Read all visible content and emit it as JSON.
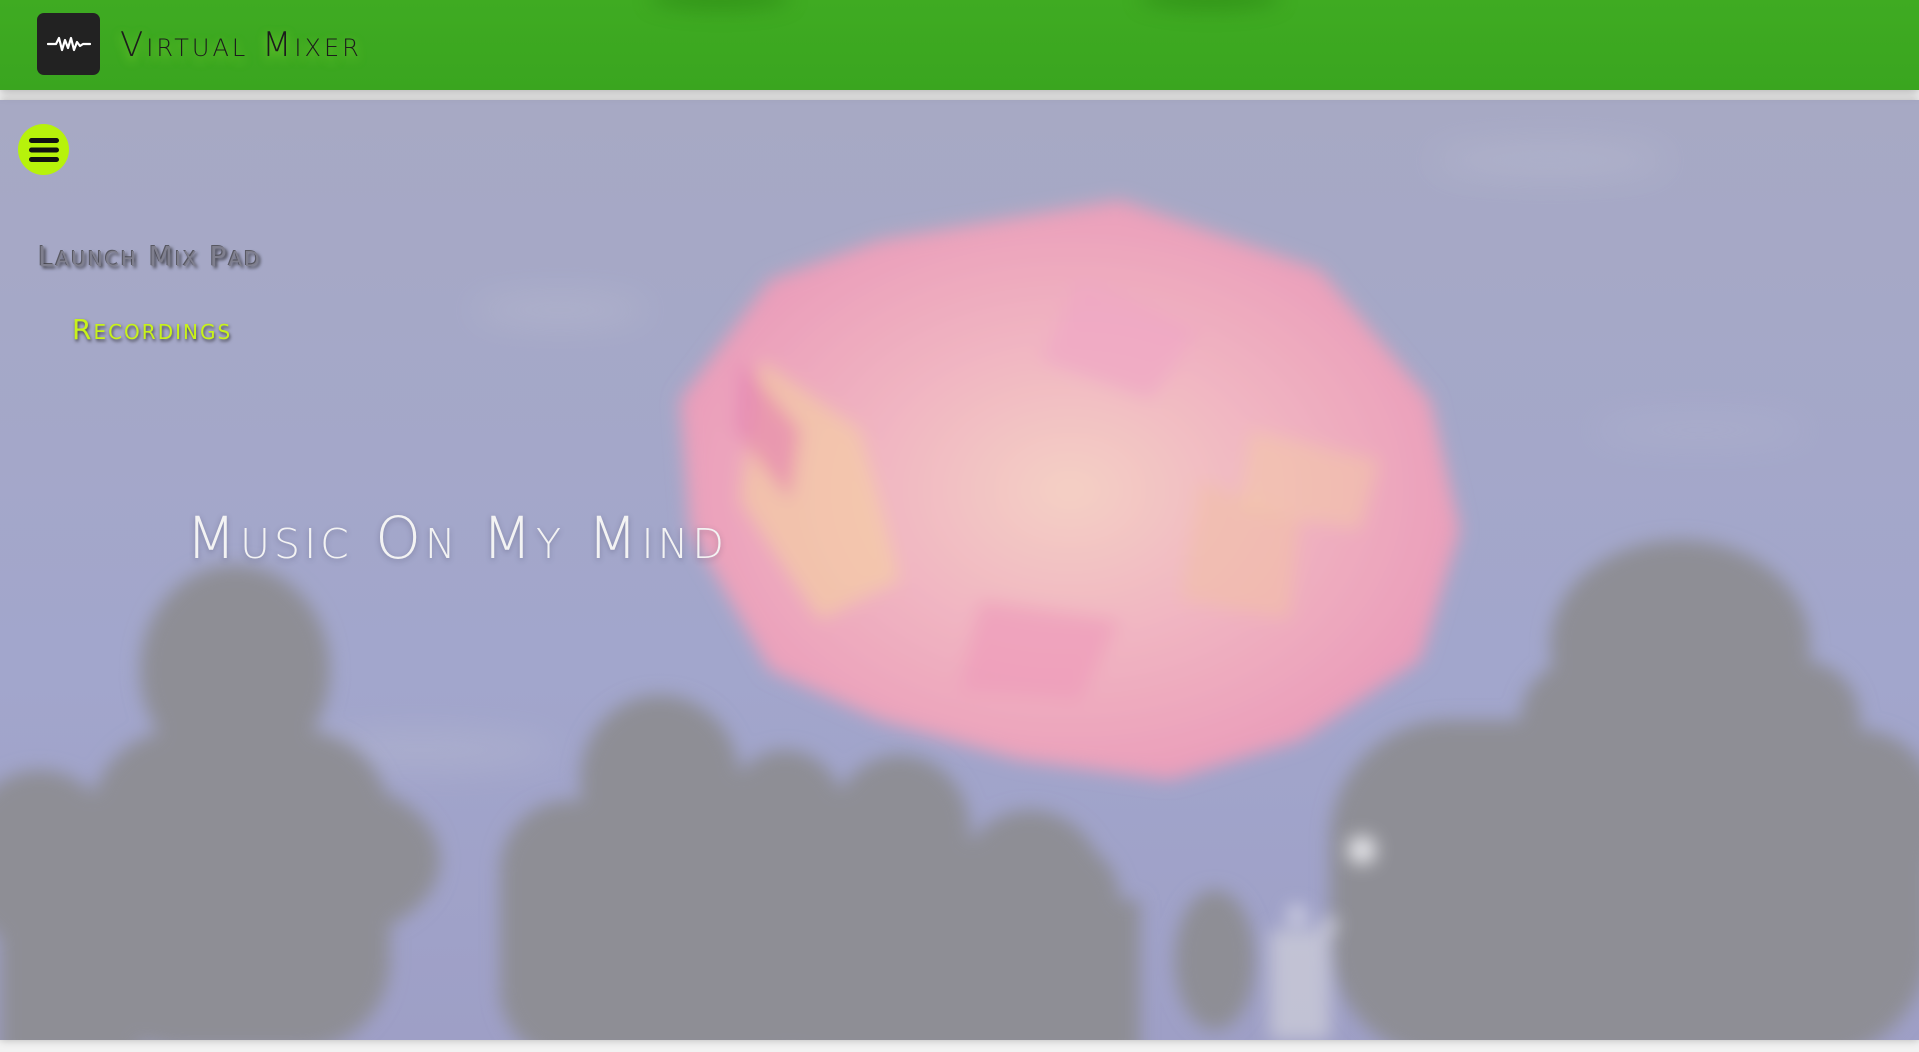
{
  "app": {
    "title": "Virtual Mixer",
    "logo_icon": "waveform-icon"
  },
  "nav": {
    "menu_icon": "hamburger-menu-icon",
    "items": [
      {
        "label": "Launch Mix Pad",
        "active": false
      },
      {
        "label": "Recordings",
        "active": true
      }
    ]
  },
  "hero": {
    "heading": "Music On My Mind",
    "background": "blurred-concert-crowd-under-pink-balloon"
  },
  "colors": {
    "topbar_green": "#3fab22",
    "accent_lime": "#b7f20b",
    "active_nav": "#c8f21a",
    "sky": "#a3a8cc",
    "balloon_pink": "#eca3bd"
  }
}
